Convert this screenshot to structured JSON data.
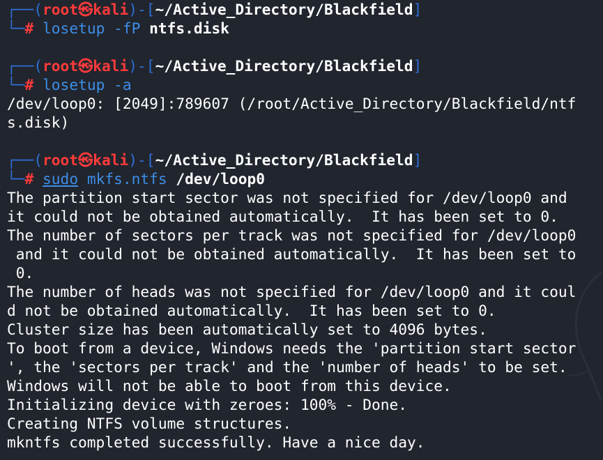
{
  "prompt": {
    "open": "┌──(",
    "user": "root",
    "skull": "㉿",
    "host": "kali",
    "mid": ")-[",
    "cwd": "~/Active_Directory/Blackfield",
    "close": "]",
    "corner": "└─",
    "hash": "#"
  },
  "blocks": [
    {
      "cmd": "losetup",
      "args": [
        {
          "text": " -fP ",
          "style": "arg"
        },
        {
          "text": "ntfs.disk",
          "style": "arg-bold"
        }
      ],
      "output": []
    },
    {
      "cmd": "losetup",
      "args": [
        {
          "text": " -a",
          "style": "arg"
        }
      ],
      "output": [
        "/dev/loop0: [2049]:789607 (/root/Active_Directory/Blackfield/ntf",
        "s.disk)"
      ]
    },
    {
      "cmd": "sudo",
      "args": [
        {
          "text": " ",
          "style": "arg"
        },
        {
          "text": "mkfs.ntfs",
          "style": "arg"
        },
        {
          "text": " ",
          "style": "arg"
        },
        {
          "text": "/dev/loop0",
          "style": "arg-bold"
        }
      ],
      "output": [
        "The partition start sector was not specified for /dev/loop0 and",
        "it could not be obtained automatically.  It has been set to 0.",
        "The number of sectors per track was not specified for /dev/loop0",
        " and it could not be obtained automatically.  It has been set to",
        " 0.",
        "The number of heads was not specified for /dev/loop0 and it coul",
        "d not be obtained automatically.  It has been set to 0.",
        "Cluster size has been automatically set to 4096 bytes.",
        "To boot from a device, Windows needs the 'partition start sector",
        "', the 'sectors per track' and the 'number of heads' to be set.",
        "Windows will not be able to boot from this device.",
        "Initializing device with zeroes: 100% - Done.",
        "Creating NTFS volume structures.",
        "mkntfs completed successfully. Have a nice day."
      ]
    }
  ]
}
